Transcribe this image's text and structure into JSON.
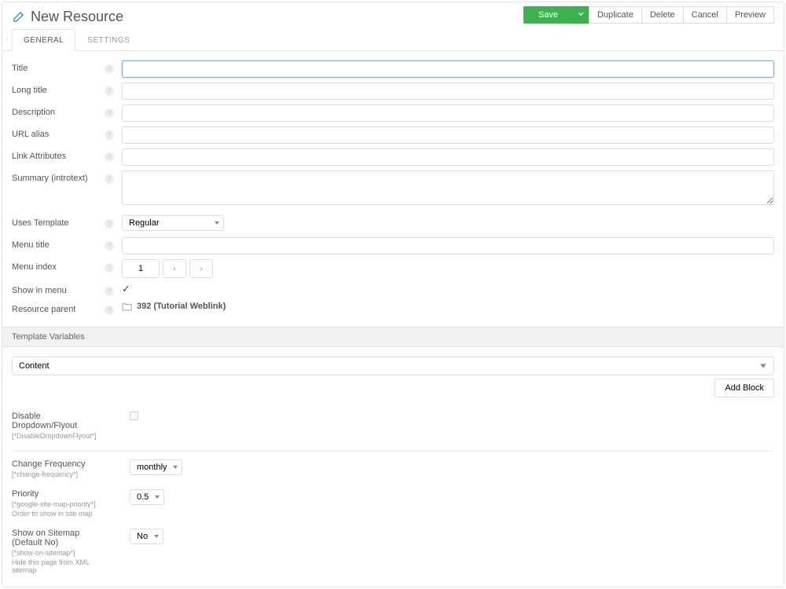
{
  "header": {
    "title": "New Resource",
    "buttons": {
      "save": "Save",
      "duplicate": "Duplicate",
      "delete": "Delete",
      "cancel": "Cancel",
      "preview": "Preview"
    }
  },
  "tabs": {
    "general": "GENERAL",
    "settings": "SETTINGS"
  },
  "fields": {
    "title": {
      "label": "Title",
      "value": ""
    },
    "longtitle": {
      "label": "Long title",
      "value": ""
    },
    "description": {
      "label": "Description",
      "value": ""
    },
    "alias": {
      "label": "URL alias",
      "value": ""
    },
    "linkattr": {
      "label": "Link Attributes",
      "value": ""
    },
    "introtext": {
      "label": "Summary (introtext)",
      "value": ""
    },
    "template": {
      "label": "Uses Template",
      "value": "Regular"
    },
    "menutitle": {
      "label": "Menu title",
      "value": ""
    },
    "menuindex": {
      "label": "Menu index",
      "value": "1"
    },
    "showinmenu": {
      "label": "Show in menu",
      "checked": true
    },
    "parent": {
      "label": "Resource parent",
      "value": "392 (Tutorial Weblink)"
    }
  },
  "tv_section": {
    "title": "Template Variables",
    "content_select": "Content",
    "add_block": "Add Block"
  },
  "tvs": {
    "disable_flyout": {
      "label": "Disable Dropdown/Flyout",
      "key": "[*DisableDropdownFlyout*]"
    },
    "change_freq": {
      "label": "Change Frequency",
      "key": "[*change-frequency*]",
      "value": "monthly"
    },
    "priority": {
      "label": "Priority",
      "key": "[*google-site-map-priority*]",
      "help": "Order to show in site map",
      "value": "0.5"
    },
    "sitemap": {
      "label": "Show on Sitemap (Default No)",
      "key": "[*show-on-sitemap*]",
      "help": "Hide this page from XML sitemap",
      "value": "No"
    }
  }
}
